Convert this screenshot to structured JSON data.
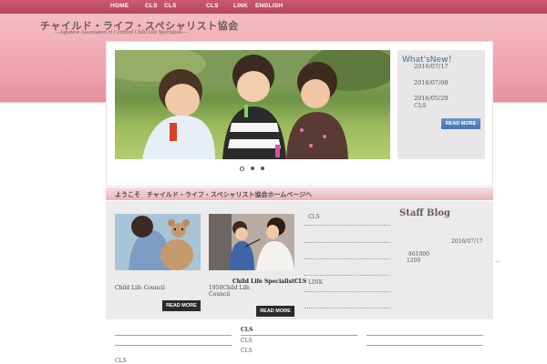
{
  "nav": {
    "items": [
      "HOME",
      "CLS",
      "CLS",
      "CLS",
      "LINK",
      "ENGLISH"
    ]
  },
  "logo": {
    "title": "チャイルド・ライフ・スペシャリスト協会",
    "subtitle": "—Japanese Association of Certified Child Life Specialists—"
  },
  "slider": {
    "dots": 3,
    "active_dot": 0
  },
  "whats_new": {
    "title": "What'sNew！",
    "dates": [
      "2016/07/17",
      "2016/07/08",
      "2016/05/29"
    ],
    "link": "CLS",
    "button": "READ MORE"
  },
  "welcome": {
    "text": "ようこそ　チャイルド・ライフ・スペシャリスト協会ホームページへ"
  },
  "cards": [
    {
      "caption": "Child Life Council",
      "button": "READ MORE"
    },
    {
      "title": "Child Life SpecialistCLS",
      "caption_line1": "1950Child Life",
      "caption_line2": "Council",
      "button": "READ MORE"
    }
  ],
  "links": {
    "top": "CLS",
    "bottom": "LINK"
  },
  "blog": {
    "title": "Staff Blog",
    "date": "2016/07/17",
    "line1": "861000",
    "line2": "1200",
    "more": "..."
  },
  "footer": {
    "col2": [
      "CLS",
      "CLS",
      "CLS"
    ],
    "col1": "CLS"
  },
  "colors": {
    "nav": "#b8455f",
    "accent_blue": "#3a6ca8",
    "footer_line": "#a5b04a"
  }
}
